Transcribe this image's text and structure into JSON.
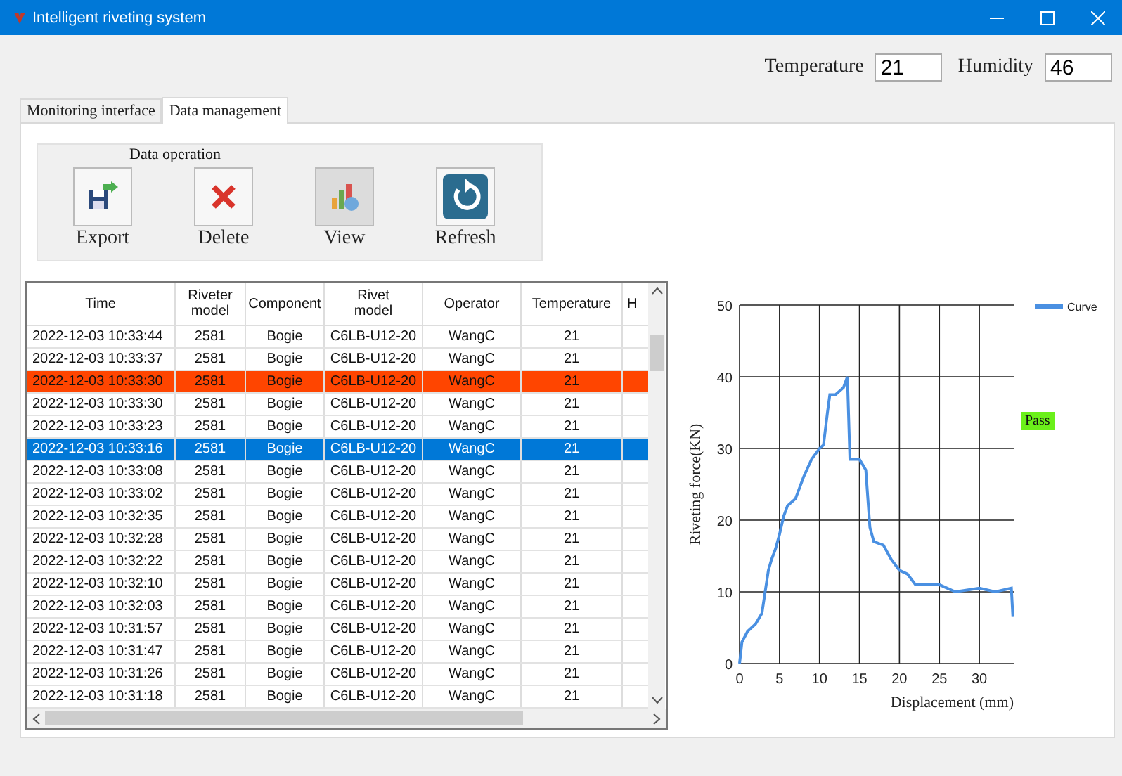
{
  "window": {
    "title": "Intelligent riveting system"
  },
  "environment": {
    "temperature_label": "Temperature",
    "temperature": "21",
    "humidity_label": "Humidity",
    "humidity": "46"
  },
  "tabs": [
    {
      "label": "Monitoring interface",
      "selected": false
    },
    {
      "label": "Data management",
      "selected": true
    }
  ],
  "data_operation": {
    "title": "Data operation",
    "buttons": [
      {
        "kind": "export",
        "label": "Export",
        "selected": false
      },
      {
        "kind": "delete",
        "label": "Delete",
        "selected": false
      },
      {
        "kind": "view",
        "label": "View",
        "selected": true
      },
      {
        "kind": "refresh",
        "label": "Refresh",
        "selected": false
      }
    ]
  },
  "table": {
    "columns": [
      "Time",
      "Riveter model",
      "Component",
      "Rivet model",
      "Operator",
      "Temperature",
      "H"
    ],
    "rows": [
      {
        "cells": [
          "2022-12-03 10:33:44",
          "2581",
          "Bogie",
          "C6LB-U12-20",
          "WangC",
          "21"
        ],
        "flagged": false,
        "selected": false
      },
      {
        "cells": [
          "2022-12-03 10:33:37",
          "2581",
          "Bogie",
          "C6LB-U12-20",
          "WangC",
          "21"
        ],
        "flagged": false,
        "selected": false
      },
      {
        "cells": [
          "2022-12-03 10:33:30",
          "2581",
          "Bogie",
          "C6LB-U12-20",
          "WangC",
          "21"
        ],
        "flagged": true,
        "selected": false
      },
      {
        "cells": [
          "2022-12-03 10:33:30",
          "2581",
          "Bogie",
          "C6LB-U12-20",
          "WangC",
          "21"
        ],
        "flagged": false,
        "selected": false
      },
      {
        "cells": [
          "2022-12-03 10:33:23",
          "2581",
          "Bogie",
          "C6LB-U12-20",
          "WangC",
          "21"
        ],
        "flagged": false,
        "selected": false
      },
      {
        "cells": [
          "2022-12-03 10:33:16",
          "2581",
          "Bogie",
          "C6LB-U12-20",
          "WangC",
          "21"
        ],
        "flagged": false,
        "selected": true
      },
      {
        "cells": [
          "2022-12-03 10:33:08",
          "2581",
          "Bogie",
          "C6LB-U12-20",
          "WangC",
          "21"
        ],
        "flagged": false,
        "selected": false
      },
      {
        "cells": [
          "2022-12-03 10:33:02",
          "2581",
          "Bogie",
          "C6LB-U12-20",
          "WangC",
          "21"
        ],
        "flagged": false,
        "selected": false
      },
      {
        "cells": [
          "2022-12-03 10:32:35",
          "2581",
          "Bogie",
          "C6LB-U12-20",
          "WangC",
          "21"
        ],
        "flagged": false,
        "selected": false
      },
      {
        "cells": [
          "2022-12-03 10:32:28",
          "2581",
          "Bogie",
          "C6LB-U12-20",
          "WangC",
          "21"
        ],
        "flagged": false,
        "selected": false
      },
      {
        "cells": [
          "2022-12-03 10:32:22",
          "2581",
          "Bogie",
          "C6LB-U12-20",
          "WangC",
          "21"
        ],
        "flagged": false,
        "selected": false
      },
      {
        "cells": [
          "2022-12-03 10:32:10",
          "2581",
          "Bogie",
          "C6LB-U12-20",
          "WangC",
          "21"
        ],
        "flagged": false,
        "selected": false
      },
      {
        "cells": [
          "2022-12-03 10:32:03",
          "2581",
          "Bogie",
          "C6LB-U12-20",
          "WangC",
          "21"
        ],
        "flagged": false,
        "selected": false
      },
      {
        "cells": [
          "2022-12-03 10:31:57",
          "2581",
          "Bogie",
          "C6LB-U12-20",
          "WangC",
          "21"
        ],
        "flagged": false,
        "selected": false
      },
      {
        "cells": [
          "2022-12-03 10:31:47",
          "2581",
          "Bogie",
          "C6LB-U12-20",
          "WangC",
          "21"
        ],
        "flagged": false,
        "selected": false
      },
      {
        "cells": [
          "2022-12-03 10:31:26",
          "2581",
          "Bogie",
          "C6LB-U12-20",
          "WangC",
          "21"
        ],
        "flagged": false,
        "selected": false
      },
      {
        "cells": [
          "2022-12-03 10:31:18",
          "2581",
          "Bogie",
          "C6LB-U12-20",
          "WangC",
          "21"
        ],
        "flagged": false,
        "selected": false
      }
    ]
  },
  "result": {
    "text": "Pass"
  },
  "chart": {
    "chart_data": {
      "type": "line",
      "xlabel": "Displacement (mm)",
      "ylabel": "Riveting force(KN)",
      "x": [
        0,
        0.3,
        1,
        2,
        2.8,
        3.2,
        3.6,
        4,
        4.5,
        5,
        5.5,
        6,
        7,
        8,
        9,
        10,
        10.5,
        11,
        11.3,
        12,
        13,
        13.5,
        13.8,
        15,
        15.8,
        16.3,
        16.8,
        18,
        19,
        20,
        21,
        22,
        25,
        27,
        30,
        32,
        34,
        34.2
      ],
      "series": [
        {
          "name": "Curve",
          "color": "#4a90e2",
          "values": [
            0,
            3,
            4.5,
            5.5,
            7,
            10,
            13,
            14.5,
            16,
            18,
            20.5,
            22,
            23,
            26,
            28.5,
            30,
            30.5,
            35,
            37.5,
            37.5,
            38.5,
            40,
            28.5,
            28.5,
            27,
            19,
            17,
            16.5,
            14.5,
            13,
            12.5,
            11,
            11,
            10,
            10.5,
            10,
            10.5,
            6.5
          ]
        }
      ],
      "xlim": [
        0,
        34.3
      ],
      "ylim": [
        0,
        50
      ],
      "xticks": [
        0,
        5,
        10,
        15,
        20,
        25,
        30
      ],
      "yticks": [
        0,
        10,
        20,
        30,
        40,
        50
      ],
      "grid": true
    }
  }
}
